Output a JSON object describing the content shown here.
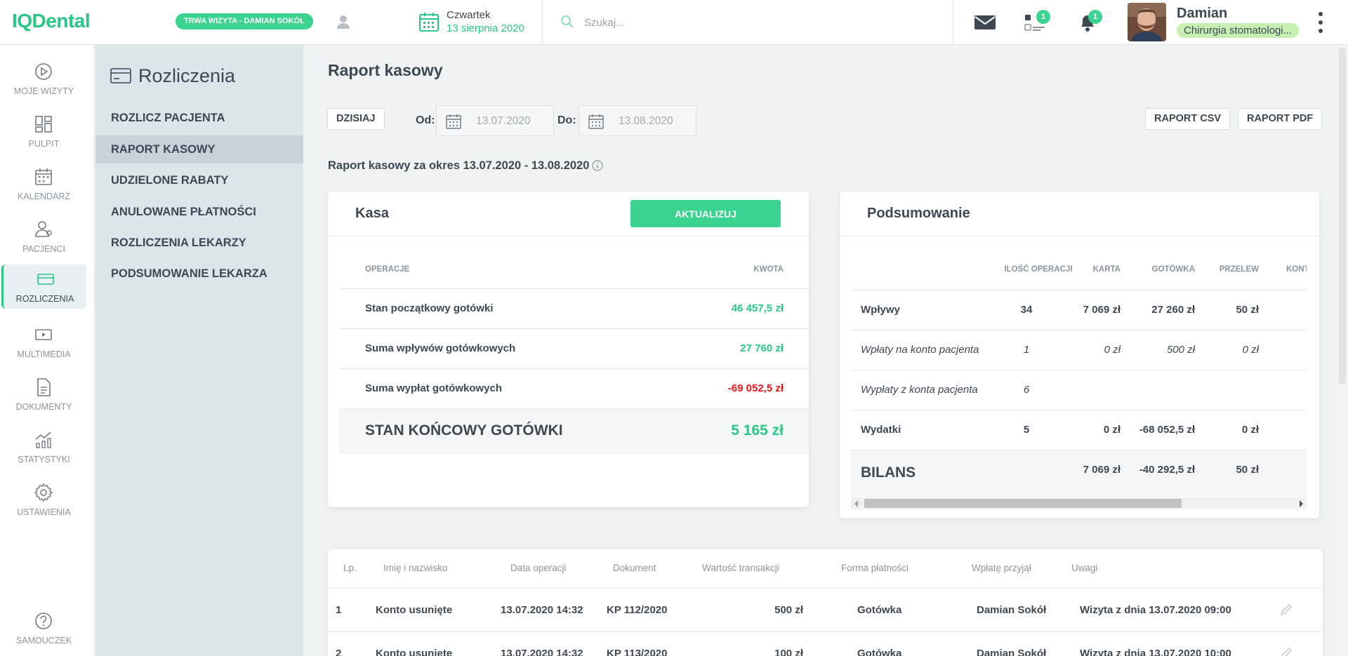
{
  "app": {
    "logo": "IQDental"
  },
  "topbar": {
    "visit_badge": "TRWA WIZYTA - DAMIAN SOKÓŁ",
    "day": "Czwartek",
    "date": "13 sierpnia 2020",
    "search_placeholder": "Szukaj...",
    "tasks_count": "1",
    "notifications_count": "1",
    "user_name": "Damian",
    "user_role": "Chirurgia stomatologi..."
  },
  "nav": [
    {
      "label": "MOJE WIZYTY",
      "icon": "play-circle-icon"
    },
    {
      "label": "PULPIT",
      "icon": "dashboard-icon"
    },
    {
      "label": "KALENDARZ",
      "icon": "calendar-icon"
    },
    {
      "label": "PACJENCI",
      "icon": "patients-icon"
    },
    {
      "label": "ROZLICZENIA",
      "icon": "credit-card-icon",
      "active": true
    },
    {
      "label": "MULTIMEDIA",
      "icon": "multimedia-icon"
    },
    {
      "label": "DOKUMENTY",
      "icon": "document-icon"
    },
    {
      "label": "STATYSTYKI",
      "icon": "statistics-icon"
    },
    {
      "label": "USTAWIENIA",
      "icon": "gear-icon"
    },
    {
      "label": "SAMOUCZEK",
      "icon": "help-icon"
    }
  ],
  "submenu": {
    "title": "Rozliczenia",
    "items": [
      {
        "label": "ROZLICZ PACJENTA"
      },
      {
        "label": "RAPORT KASOWY",
        "active": true
      },
      {
        "label": "UDZIELONE RABATY"
      },
      {
        "label": "ANULOWANE PŁATNOŚCI"
      },
      {
        "label": "ROZLICZENIA LEKARZY"
      },
      {
        "label": "PODSUMOWANIE LEKARZA"
      }
    ]
  },
  "main": {
    "title": "Raport kasowy",
    "today_btn": "DZISIAJ",
    "from_label": "Od:",
    "from_value": "13.07.2020",
    "to_label": "Do:",
    "to_value": "13.08.2020",
    "csv_btn": "RAPORT CSV",
    "pdf_btn": "RAPORT PDF",
    "period": "Raport kasowy za okres 13.07.2020 - 13.08.2020"
  },
  "kasa": {
    "title": "Kasa",
    "update_btn": "AKTUALIZUJ",
    "col_ops": "OPERACJE",
    "col_amount": "KWOTA",
    "rows": [
      {
        "label": "Stan początkowy gotówki",
        "value": "46 457,5 zł"
      },
      {
        "label": "Suma wpływów gotówkowych",
        "value": "27 760 zł"
      },
      {
        "label": "Suma wypłat gotówkowych",
        "value": "-69 052,5 zł"
      }
    ],
    "final_label": "STAN KOŃCOWY GOTÓWKI",
    "final_value": "5 165 zł"
  },
  "summary": {
    "title": "Podsumowanie",
    "headers": [
      "ILOŚĆ OPERACJI",
      "KARTA",
      "GOTÓWKA",
      "PRZELEW",
      "KONT"
    ],
    "rows": [
      {
        "label": "Wpływy",
        "count": "34",
        "card": "7 069 zł",
        "cash": "27 260 zł",
        "transfer": "50 zł"
      },
      {
        "label": "Wpłaty na konto pacjenta",
        "count": "1",
        "card": "0 zł",
        "cash": "500 zł",
        "transfer": "0 zł"
      },
      {
        "label": "Wypłaty z konta pacjenta",
        "count": "6",
        "card": "",
        "cash": "",
        "transfer": ""
      },
      {
        "label": "Wydatki",
        "count": "5",
        "card": "0 zł",
        "cash": "-68 052,5 zł",
        "transfer": "0 zł"
      }
    ],
    "bilans_label": "BILANS",
    "bilans": {
      "card": "7 069 zł",
      "cash": "-40 292,5 zł",
      "transfer": "50 zł"
    }
  },
  "transactions": {
    "headers": [
      "Lp.",
      "Imię i nazwisko",
      "Data operacji",
      "Dokument",
      "Wartość transakcji",
      "Forma płatności",
      "Wpłatę przyjął",
      "Uwagi"
    ],
    "rows": [
      {
        "lp": "1",
        "name": "Konto usunięte",
        "date": "13.07.2020 14:32",
        "doc": "KP 112/2020",
        "value": "500 zł",
        "method": "Gotówka",
        "received_by": "Damian Sokół",
        "notes": "Wizyta z dnia 13.07.2020 09:00"
      },
      {
        "lp": "2",
        "name": "Konto usunięte",
        "date": "13.07.2020 14:32",
        "doc": "KP 113/2020",
        "value": "100 zł",
        "method": "Gotówka",
        "received_by": "Damian Sokół",
        "notes": "Wizyta z dnia 13.07.2020 10:00"
      }
    ]
  },
  "colors": {
    "accent": "#3ad38f",
    "negative": "#e8151a",
    "submenu_bg": "#dbe5ea"
  }
}
